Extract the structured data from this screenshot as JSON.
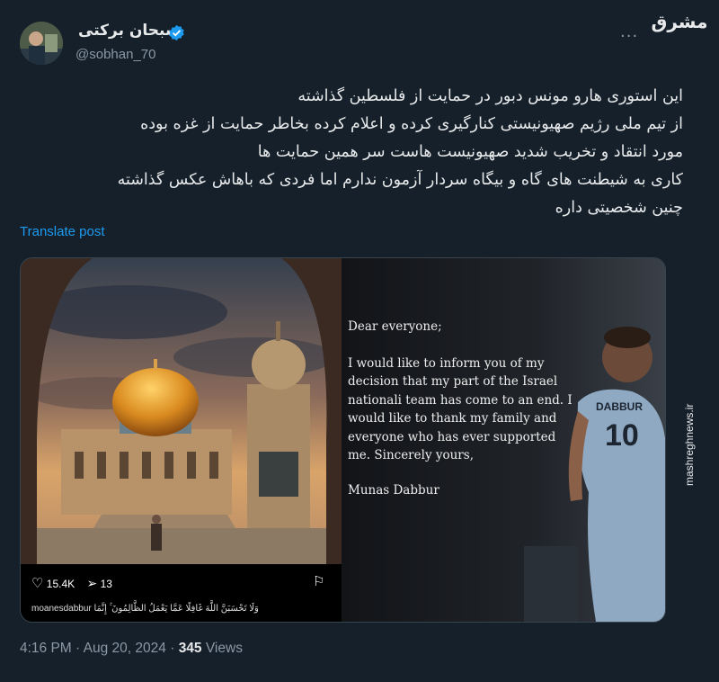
{
  "author": {
    "name": "سبحان برکتی",
    "handle": "@sobhan_70",
    "verified": true
  },
  "watermark": {
    "logo": "مشرق",
    "site": "mashreghnews.ir"
  },
  "tweet": {
    "lines": [
      "این استوری هارو مونس دبور در حمایت از فلسطین گذاشته",
      "از تیم ملی رژیم صهیونیستی کنارگیری کرده و اعلام کرده بخاطر حمایت از غزه بوده",
      "مورد انتقاد و تخریب شدید صهیونیست هاست سر همین حمایت ها",
      "کاری به شیطنت های گاه و بیگاه سردار آزمون ندارم اما فردی که باهاش عکس گذاشته",
      "چنین شخصیتی داره"
    ],
    "translate_label": "Translate post"
  },
  "media": {
    "instagram": {
      "likes": "15.4K",
      "shares": "13",
      "caption": "moanesdabbur وَلَا تَحْسَبَنَّ اللَّهَ غَافِلًا عَمَّا يَعْمَلُ الظَّالِمُونَ ۚ إِنَّمَا"
    },
    "letter": {
      "greeting": "Dear everyone;",
      "body": "I would like to inform you of my decision that my part of the Israel nationali team has come to an end. I would like to thank my family and everyone who has ever supported me. Sincerely yours,",
      "signature": "Munas Dabbur"
    },
    "jersey": {
      "name": "DABBUR",
      "number": "10"
    }
  },
  "meta": {
    "time": "4:16 PM",
    "date": "Aug 20, 2024",
    "views_count": "345",
    "views_label": "Views"
  },
  "colors": {
    "background": "#15202b",
    "accent": "#1d9bf0",
    "muted": "#8b98a5"
  }
}
